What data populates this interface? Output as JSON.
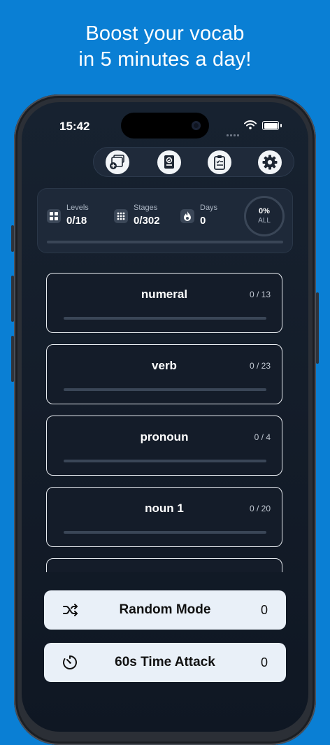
{
  "headline": {
    "line1": "Boost your vocab",
    "line2": "in 5 minutes a day!"
  },
  "status_bar": {
    "time": "15:42"
  },
  "toolbar": {
    "buttons": [
      {
        "icon": "add-cards-icon"
      },
      {
        "icon": "book-check-icon"
      },
      {
        "icon": "clipboard-list-icon"
      },
      {
        "icon": "gear-icon"
      }
    ]
  },
  "stats": {
    "levels": {
      "label": "Levels",
      "value": "0/18",
      "icon": "grid-icon"
    },
    "stages": {
      "label": "Stages",
      "value": "0/302",
      "icon": "dots-grid-icon"
    },
    "days": {
      "label": "Days",
      "value": "0",
      "icon": "flame-icon"
    },
    "overall": {
      "percent": "0%",
      "label": "ALL",
      "progress": 0
    }
  },
  "levels": [
    {
      "name": "numeral",
      "count": "0 / 13",
      "progress": 0
    },
    {
      "name": "verb",
      "count": "0 / 23",
      "progress": 0
    },
    {
      "name": "pronoun",
      "count": "0 / 4",
      "progress": 0
    },
    {
      "name": "noun 1",
      "count": "0 / 20",
      "progress": 0
    },
    {
      "name": "",
      "count": "",
      "progress": 0
    }
  ],
  "modes": {
    "random": {
      "label": "Random Mode",
      "count": "0",
      "icon": "shuffle-icon"
    },
    "time_attack": {
      "label": "60s Time Attack",
      "count": "0",
      "icon": "timer-icon"
    }
  },
  "colors": {
    "background": "#0a7fd4",
    "screen": "#141d2a",
    "card_border": "#e7ebf0",
    "button_bg": "#e9f0f8"
  }
}
